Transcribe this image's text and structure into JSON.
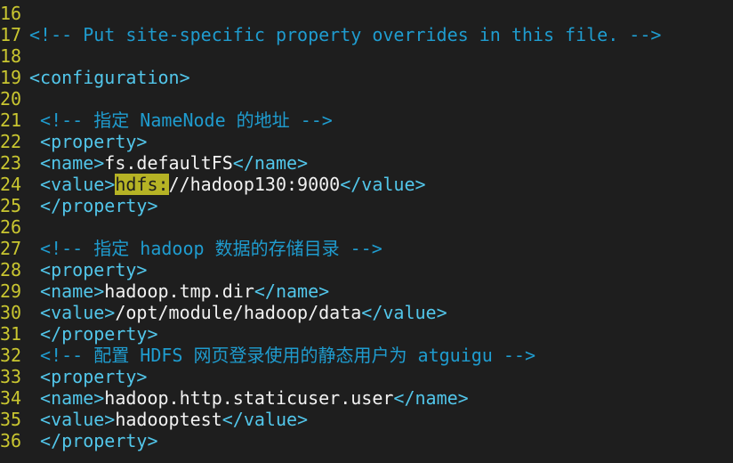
{
  "colors": {
    "background": "#1e1e1e",
    "line_number": "#c9c630",
    "comment": "#1f9ccf",
    "tag": "#52c6ea",
    "text": "#f2f2f2",
    "search_highlight": "#b6b325"
  },
  "lines": [
    {
      "n": "16",
      "segs": []
    },
    {
      "n": "17",
      "segs": [
        [
          "comment",
          "<!-- Put site-specific property overrides in this file. -->"
        ]
      ]
    },
    {
      "n": "18",
      "segs": []
    },
    {
      "n": "19",
      "segs": [
        [
          "tag",
          "<configuration>"
        ]
      ]
    },
    {
      "n": "20",
      "segs": []
    },
    {
      "n": "21",
      "segs": [
        [
          "text",
          " "
        ],
        [
          "comment",
          "<!-- 指定 NameNode 的地址 -->"
        ]
      ]
    },
    {
      "n": "22",
      "segs": [
        [
          "text",
          " "
        ],
        [
          "tag",
          "<property>"
        ]
      ]
    },
    {
      "n": "23",
      "segs": [
        [
          "text",
          " "
        ],
        [
          "tag",
          "<name>"
        ],
        [
          "text",
          "fs.defaultFS"
        ],
        [
          "tag",
          "</name>"
        ]
      ]
    },
    {
      "n": "24",
      "segs": [
        [
          "text",
          " "
        ],
        [
          "tag",
          "<value>"
        ],
        [
          "search",
          "hdfs:"
        ],
        [
          "text",
          "//hadoop130:9000"
        ],
        [
          "tag",
          "</value>"
        ]
      ]
    },
    {
      "n": "25",
      "segs": [
        [
          "text",
          " "
        ],
        [
          "tag",
          "</property>"
        ]
      ]
    },
    {
      "n": "26",
      "segs": []
    },
    {
      "n": "27",
      "segs": [
        [
          "text",
          " "
        ],
        [
          "comment",
          "<!-- 指定 hadoop 数据的存储目录 -->"
        ]
      ]
    },
    {
      "n": "28",
      "segs": [
        [
          "text",
          " "
        ],
        [
          "tag",
          "<property>"
        ]
      ]
    },
    {
      "n": "29",
      "segs": [
        [
          "text",
          " "
        ],
        [
          "tag",
          "<name>"
        ],
        [
          "text",
          "hadoop.tmp.dir"
        ],
        [
          "tag",
          "</name>"
        ]
      ]
    },
    {
      "n": "30",
      "segs": [
        [
          "text",
          " "
        ],
        [
          "tag",
          "<value>"
        ],
        [
          "text",
          "/opt/module/hadoop/data"
        ],
        [
          "tag",
          "</value>"
        ]
      ]
    },
    {
      "n": "31",
      "segs": [
        [
          "text",
          " "
        ],
        [
          "tag",
          "</property>"
        ]
      ]
    },
    {
      "n": "32",
      "segs": [
        [
          "text",
          " "
        ],
        [
          "comment",
          "<!-- 配置 HDFS 网页登录使用的静态用户为 atguigu -->"
        ]
      ]
    },
    {
      "n": "33",
      "segs": [
        [
          "text",
          " "
        ],
        [
          "tag",
          "<property>"
        ]
      ]
    },
    {
      "n": "34",
      "segs": [
        [
          "text",
          " "
        ],
        [
          "tag",
          "<name>"
        ],
        [
          "text",
          "hadoop.http.staticuser.user"
        ],
        [
          "tag",
          "</name>"
        ]
      ]
    },
    {
      "n": "35",
      "segs": [
        [
          "text",
          " "
        ],
        [
          "tag",
          "<value>"
        ],
        [
          "text",
          "hadooptest"
        ],
        [
          "tag",
          "</value>"
        ]
      ]
    },
    {
      "n": "36",
      "segs": [
        [
          "text",
          " "
        ],
        [
          "tag",
          "</property>"
        ]
      ]
    }
  ]
}
